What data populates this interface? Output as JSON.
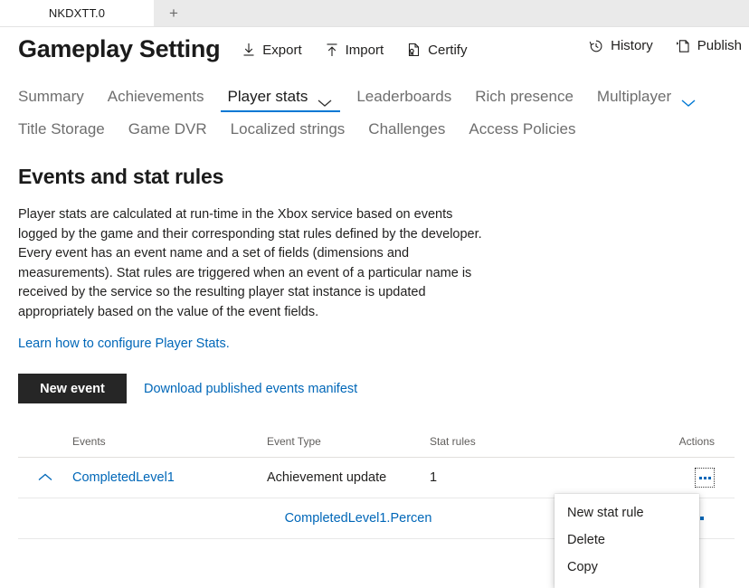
{
  "browser": {
    "tab_title": "NKDXTT.0",
    "new_tab_label": "+"
  },
  "header": {
    "app_title": "Gameplay Setting",
    "left_commands": [
      {
        "label": "Export",
        "icon": "download-icon"
      },
      {
        "label": "Import",
        "icon": "upload-icon"
      },
      {
        "label": "Certify",
        "icon": "certificate-icon"
      }
    ],
    "right_commands": [
      {
        "label": "History",
        "icon": "history-clock-icon"
      },
      {
        "label": "Publish",
        "icon": "publish-document-icon"
      }
    ]
  },
  "nav": {
    "row1": [
      {
        "label": "Summary",
        "selected": false,
        "chevron": false
      },
      {
        "label": "Achievements",
        "selected": false,
        "chevron": false
      },
      {
        "label": "Player stats",
        "selected": true,
        "chevron": true
      },
      {
        "label": "Leaderboards",
        "selected": false,
        "chevron": false
      },
      {
        "label": "Rich presence",
        "selected": false,
        "chevron": false
      },
      {
        "label": "Multiplayer",
        "selected": false,
        "chevron": true
      }
    ],
    "row2": [
      {
        "label": "Title Storage"
      },
      {
        "label": "Game DVR"
      },
      {
        "label": "Localized strings"
      },
      {
        "label": "Challenges"
      },
      {
        "label": "Access Policies"
      }
    ]
  },
  "main": {
    "heading": "Events and stat rules",
    "description": "Player stats are calculated at run-time in the Xbox service based on events logged by the game and their corresponding stat rules defined by the developer. Every event has an event name and a set of fields (dimensions and measurements). Stat rules are triggered when an event of a particular name is received by the service so the resulting player stat instance is updated appropriately based on the value of the event fields.",
    "learn_link": "Learn how to configure Player Stats.",
    "new_event_button": "New event",
    "download_link": "Download published events manifest"
  },
  "table": {
    "columns": [
      "Events",
      "Event Type",
      "Stat rules",
      "Actions"
    ],
    "rows": [
      {
        "expanded": true,
        "event": "CompletedLevel1",
        "event_type": "Achievement update",
        "stat_rules": "1",
        "actions_icon": "ellipsis-icon"
      }
    ],
    "sub_rows": [
      {
        "stat_rule_name": "CompletedLevel1.Percen"
      }
    ]
  },
  "context_menu": {
    "items": [
      "New stat rule",
      "Delete",
      "Copy"
    ]
  },
  "colors": {
    "accent": "#0078d4",
    "link": "#0067b8",
    "primary_button_bg": "#262626",
    "text": "#201f1e",
    "muted_text": "#6e6e6e"
  }
}
